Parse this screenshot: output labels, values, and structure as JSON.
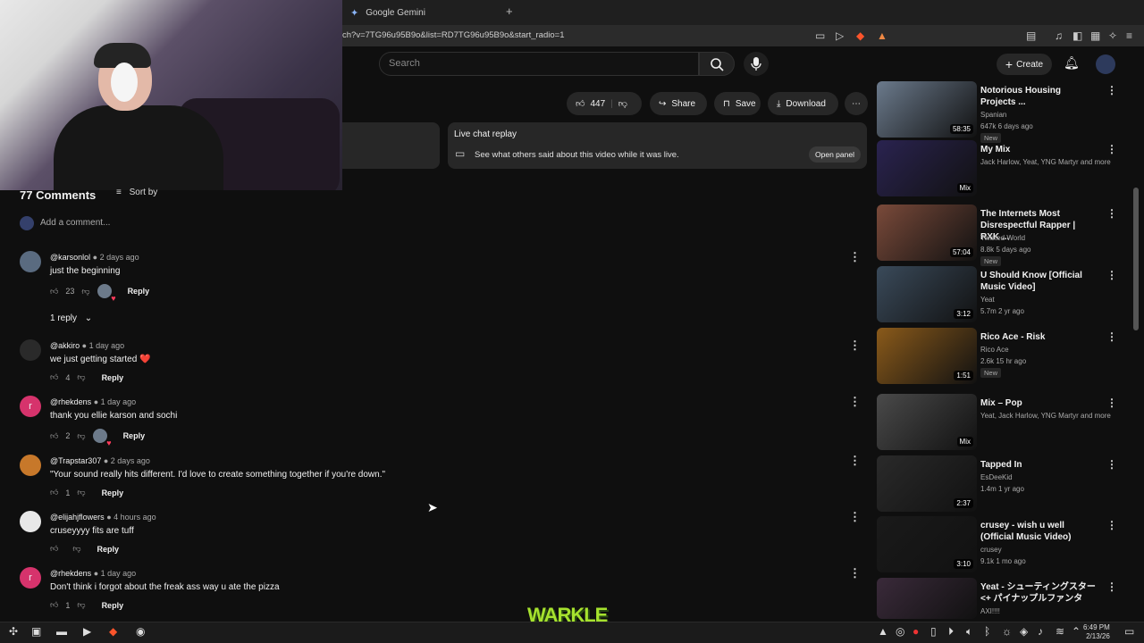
{
  "browser": {
    "tab_title": "Google Gemini",
    "new_tab": "+",
    "url": "ch?v=7TG96u95B9o&list=RD7TG96u95B9o&start_radio=1"
  },
  "youtube": {
    "search_placeholder": "Search",
    "create_label": "Create"
  },
  "actions": {
    "likes": "447",
    "share": "Share",
    "save": "Save",
    "download": "Download"
  },
  "live_chat": {
    "title": "Live chat replay",
    "description": "See what others said about this video while it was live.",
    "open_panel": "Open panel"
  },
  "comments": {
    "count_label": "77 Comments",
    "sort_label": "Sort by",
    "add_placeholder": "Add a comment...",
    "replies_label": "1 reply",
    "reply_label": "Reply",
    "items": [
      {
        "user": "@karsonlol",
        "time": "2 days ago",
        "text": "just the beginning",
        "likes": "23",
        "avatar_color": "#5a6b80",
        "initial": ""
      },
      {
        "user": "@akkiro",
        "time": "1 day ago",
        "text": "we just getting started ❤️",
        "likes": "4",
        "avatar_color": "#2a2a2a",
        "initial": ""
      },
      {
        "user": "@rhekdens",
        "time": "1 day ago",
        "text": "thank you ellie karson and sochi",
        "likes": "2",
        "avatar_color": "#d6336c",
        "initial": "r"
      },
      {
        "user": "@Trapstar307",
        "time": "2 days ago",
        "text": "\"Your sound really hits different. I'd love to create something together if you're down.\"",
        "likes": "1",
        "avatar_color": "#c7782a",
        "initial": ""
      },
      {
        "user": "@elijahjflowers",
        "time": "4 hours ago",
        "text": "cruseyyyy fits are tuff",
        "likes": "",
        "avatar_color": "#e8e8e8",
        "initial": ""
      },
      {
        "user": "@rhekdens",
        "time": "1 day ago",
        "text": "Don't think i forgot about the freak ass way u ate the pizza",
        "likes": "1",
        "avatar_color": "#d6336c",
        "initial": "r"
      }
    ]
  },
  "sidebar": {
    "items": [
      {
        "title": "Notorious Housing Projects ...",
        "channel": "Spanian",
        "meta": "647k  6 days ago",
        "badge": "New",
        "duration": "58:35",
        "thumb": "#6b7a8c"
      },
      {
        "title": "My Mix",
        "channel": "Jack Harlow, Yeat, YNG Martyr and more",
        "meta": "",
        "badge": "",
        "duration": "Mix",
        "thumb": "#2a2350"
      },
      {
        "title": "The Internets Most Disrespectful Rapper | RXK ...",
        "channel": "Twisted World",
        "meta": "8.8k  5 days ago",
        "badge": "New",
        "duration": "57:04",
        "thumb": "#7a4a3a"
      },
      {
        "title": "U Should Know [Official Music Video]",
        "channel": "Yeat",
        "meta": "5.7m  2 yr ago",
        "badge": "",
        "duration": "3:12",
        "thumb": "#3a4a5a"
      },
      {
        "title": "Rico Ace - Risk",
        "channel": "Rico Ace",
        "meta": "2.6k  15 hr ago",
        "badge": "New",
        "duration": "1:51",
        "thumb": "#8a5a1a"
      },
      {
        "title": "Mix – Pop",
        "channel": "Yeat, Jack Harlow, YNG Martyr and more",
        "meta": "",
        "badge": "",
        "duration": "Mix",
        "thumb": "#4a4a4a"
      },
      {
        "title": "Tapped In",
        "channel": "EsDeeKid",
        "meta": "1.4m  1 yr ago",
        "badge": "",
        "duration": "2:37",
        "thumb": "#2a2a2a"
      },
      {
        "title": "crusey - wish u well (Official Music Video)",
        "channel": "crusey",
        "meta": "9.1k  1 mo ago",
        "badge": "",
        "duration": "3:10",
        "thumb": "#1a1a1a"
      },
      {
        "title": "Yeat - シューティングスター<+ パイナップルファンタ",
        "channel": "AXI!!!!",
        "meta": "",
        "badge": "",
        "duration": "",
        "thumb": "#3a2a3a"
      }
    ]
  },
  "taskbar": {
    "time": "6:49 PM",
    "date": "2/13/26",
    "logo_text": "WARKLE"
  }
}
